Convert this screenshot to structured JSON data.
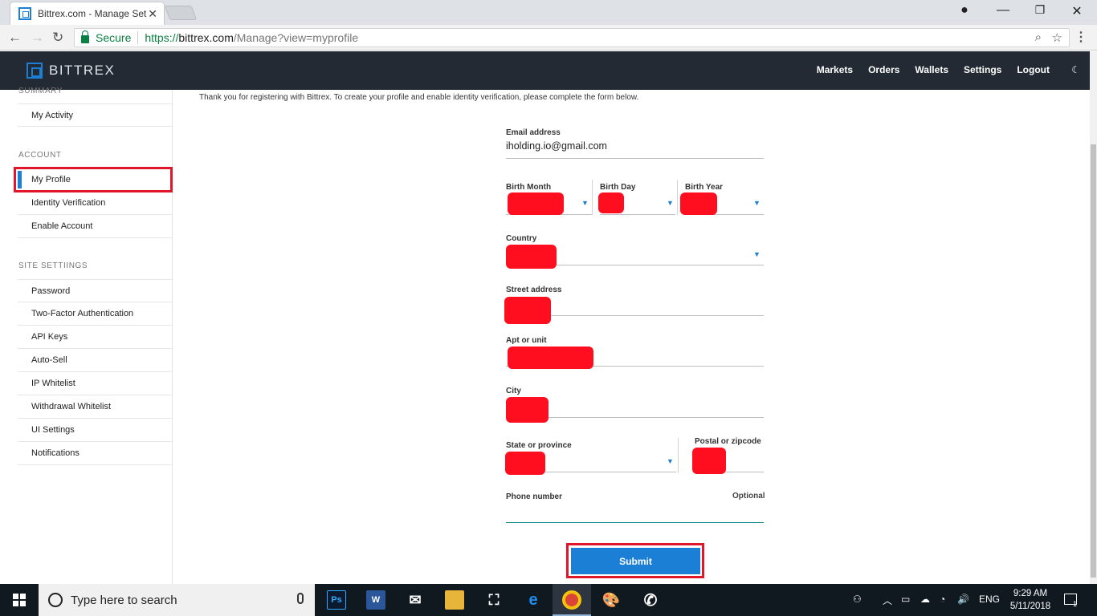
{
  "browser": {
    "tab_title": "Bittrex.com - Manage Set",
    "secure_label": "Secure",
    "url_protocol": "https://",
    "url_host": "bittrex.com",
    "url_path": "/Manage?view=myprofile"
  },
  "site": {
    "logo_text": "BITTREX",
    "nav": [
      "Markets",
      "Orders",
      "Wallets",
      "Settings",
      "Logout"
    ]
  },
  "sidebar": {
    "summary_heading": "SUMMARY",
    "summary_items": [
      "My Activity"
    ],
    "account_heading": "ACCOUNT",
    "account_items": [
      "My Profile",
      "Identity Verification",
      "Enable Account"
    ],
    "site_settings_heading": "SITE SETTIINGS",
    "site_settings_items": [
      "Password",
      "Two-Factor Authentication",
      "API Keys",
      "Auto-Sell",
      "IP Whitelist",
      "Withdrawal Whitelist",
      "UI Settings",
      "Notifications"
    ]
  },
  "main": {
    "intro": "Thank you for registering with Bittrex. To create your profile and enable identity verification, please complete the form below.",
    "form": {
      "email_label": "Email address",
      "email_value": "iholding.io@gmail.com",
      "birth_month_label": "Birth Month",
      "birth_day_label": "Birth Day",
      "birth_year_label": "Birth Year",
      "country_label": "Country",
      "street_label": "Street address",
      "apt_label": "Apt or unit",
      "city_label": "City",
      "state_label": "State or province",
      "postal_label": "Postal or zipcode",
      "phone_label": "Phone number",
      "phone_optional": "Optional",
      "submit_label": "Submit"
    },
    "redaction_color": "#ff0e1f",
    "accent_color": "#1c7fd6",
    "highlight_color": "#e0162b"
  },
  "taskbar": {
    "search_placeholder": "Type here to search",
    "apps": [
      "photoshop-icon",
      "word-icon",
      "mail-icon",
      "file-explorer-icon",
      "store-icon",
      "edge-icon",
      "chrome-icon",
      "paint-icon",
      "phone-icon"
    ],
    "language": "ENG",
    "time": "9:29 AM",
    "date": "5/11/2018",
    "notification_count": "1"
  }
}
